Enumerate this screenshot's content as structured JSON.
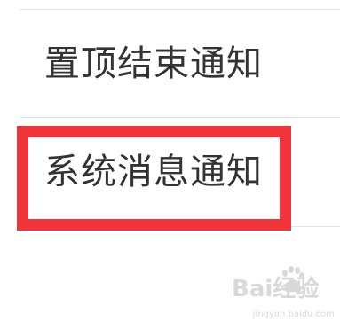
{
  "settings_list": {
    "items": [
      {
        "label": "置顶结束通知"
      },
      {
        "label": "系统消息通知"
      }
    ]
  },
  "annotation": {
    "highlight_color": "#f0343a",
    "highlighted_item": "系统消息通知"
  },
  "watermark": {
    "logo_text": "Bai经验",
    "url": "jingyan.baidu.com"
  }
}
